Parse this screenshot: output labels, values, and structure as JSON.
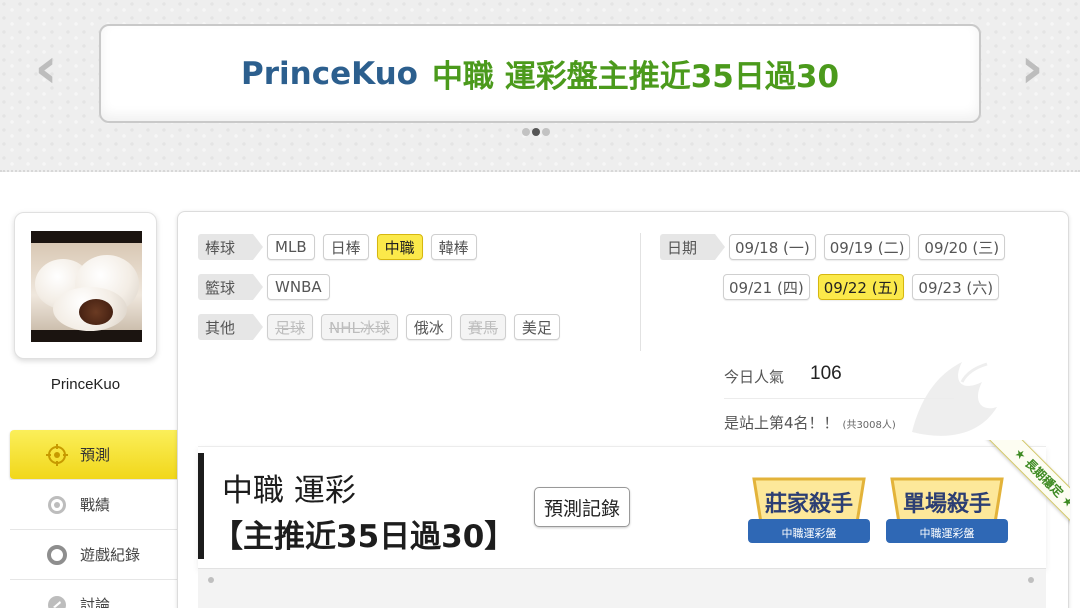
{
  "banner": {
    "user": "PrinceKuo",
    "title": "中職 運彩盤主推近35日過30",
    "prev_icon": "chevron-left-icon",
    "next_icon": "chevron-right-icon",
    "dots_count": 3,
    "active_dot": 1
  },
  "profile": {
    "name": "PrinceKuo",
    "avatar": "steamed-bun-photo"
  },
  "nav": {
    "items": [
      {
        "label": "預測",
        "icon": "target-icon",
        "active": true
      },
      {
        "label": "戰績",
        "icon": "spiral-icon",
        "active": false
      },
      {
        "label": "遊戲紀錄",
        "icon": "circle-icon",
        "active": false
      },
      {
        "label": "討論",
        "icon": "chat-icon",
        "active": false
      }
    ]
  },
  "filters": {
    "baseball": {
      "label": "棒球",
      "items": [
        "MLB",
        "日棒",
        "中職",
        "韓棒"
      ],
      "selected": "中職"
    },
    "basketball": {
      "label": "籃球",
      "items": [
        "WNBA"
      ]
    },
    "other": {
      "label": "其他",
      "items": [
        "足球",
        "NHL冰球",
        "俄冰",
        "賽馬",
        "美足"
      ],
      "disabled": [
        "足球",
        "NHL冰球",
        "賽馬"
      ]
    }
  },
  "dates": {
    "label": "日期",
    "items": [
      "09/18 (一)",
      "09/19 (二)",
      "09/20 (三)",
      "09/21 (四)",
      "09/22 (五)",
      "09/23 (六)"
    ],
    "selected": "09/22 (五)"
  },
  "stats": {
    "popularity_label": "今日人氣",
    "popularity_value": "106",
    "rank_text": "是站上第4名！！",
    "rank_total": "(共3008人)"
  },
  "prediction": {
    "title": "中職 運彩",
    "subtitle": "【主推近35日過30】",
    "record_button": "預測記錄",
    "badges": [
      {
        "title": "莊家殺手",
        "sub": "中職運彩盤"
      },
      {
        "title": "單場殺手",
        "sub": "中職運彩盤"
      }
    ],
    "ribbon": "★ 長期穩定 ★"
  },
  "colors": {
    "accent_yellow": "#fbe94a",
    "banner_user": "#2c5f8e",
    "banner_title": "#4b9a1c"
  }
}
